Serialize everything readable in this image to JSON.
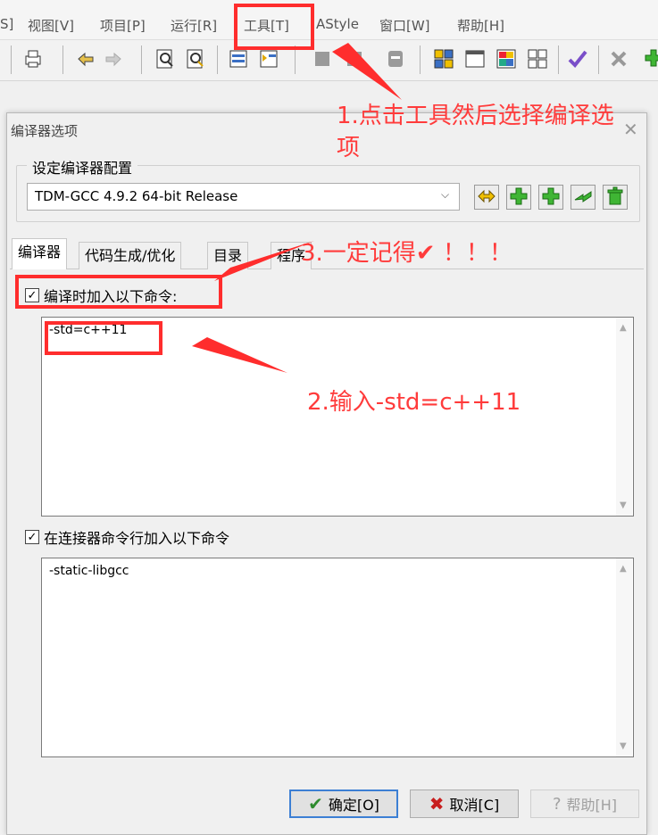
{
  "menubar": {
    "items": [
      {
        "label": "S]"
      },
      {
        "label": "视图[V]"
      },
      {
        "label": "项目[P]"
      },
      {
        "label": "运行[R]"
      },
      {
        "label": "工具[T]"
      },
      {
        "label": "AStyle"
      },
      {
        "label": "窗口[W]"
      },
      {
        "label": "帮助[H]"
      }
    ]
  },
  "dialog": {
    "title": "编译器选项",
    "config_group_label": "设定编译器配置",
    "compiler_config": "TDM-GCC 4.9.2 64-bit Release",
    "tabs": [
      {
        "label": "编译器"
      },
      {
        "label": "代码生成/优化"
      },
      {
        "label": "目录"
      },
      {
        "label": "程序"
      }
    ],
    "compile_cmd_checkbox": "编译时加入以下命令:",
    "compile_cmd_value": "-std=c++11",
    "linker_cmd_checkbox": "在连接器命令行加入以下命令",
    "linker_cmd_value": "-static-libgcc",
    "buttons": {
      "ok": "确定[O]",
      "cancel": "取消[C]",
      "help": "帮助[H]"
    }
  },
  "annotations": {
    "step1": "1.点击工具然后选择编译选项",
    "step2": "2.输入-std=c++11",
    "step3": "3.一定记得✔ ！！！"
  },
  "colors": {
    "annotation": "#ff2d2d",
    "ok_border": "#3c7fd4",
    "check_green": "#2e8b2e",
    "cancel_red": "#c81e1e"
  }
}
